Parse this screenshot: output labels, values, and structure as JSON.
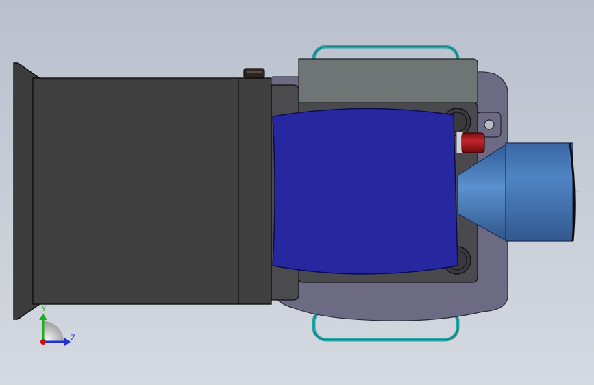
{
  "triad": {
    "y_label": "Y",
    "z_label": "Z",
    "y_color": "#1fae1f",
    "z_color": "#2233cc",
    "origin_color": "#cc1111"
  },
  "colors": {
    "background_top": "#b9c0cc",
    "background_bottom": "#d5d9e0",
    "housing": "#404040",
    "base_plate": "#6d6a84",
    "motor_body": "#2727a0",
    "top_block": "#6f7575",
    "nozzle": "#3f6fae",
    "handle": "#2aa7a7",
    "red_knob": "#a0151a"
  }
}
